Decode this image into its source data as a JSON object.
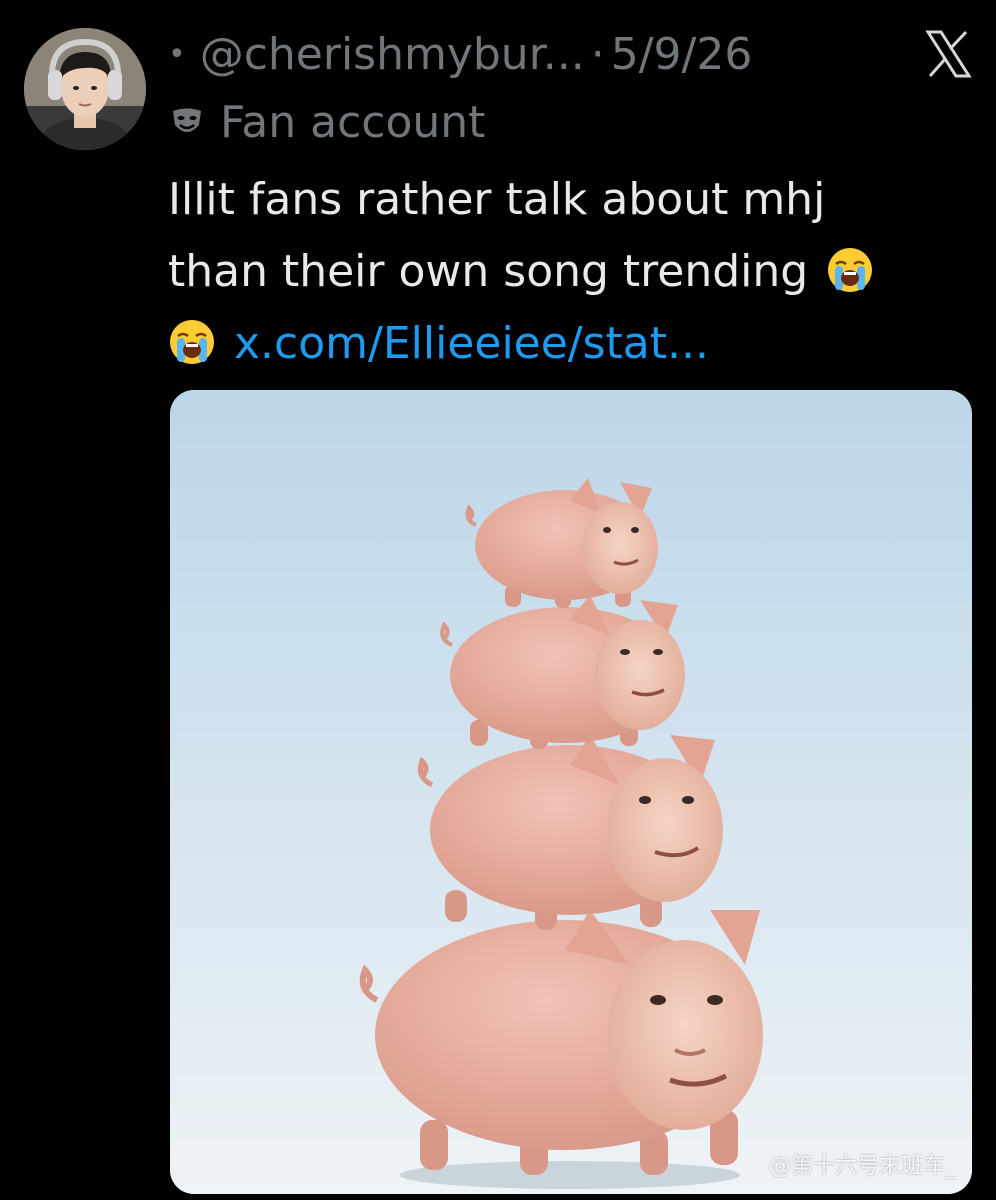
{
  "tweet": {
    "handle": "@cherishmybur...",
    "separator": "·",
    "date": "5/9/26",
    "label": "Fan account",
    "text_line1": "Illit fans rather talk about mhj",
    "text_line2": "than their own song trending",
    "link": "x.com/Ellieeiee/stat..."
  },
  "media": {
    "watermark": "@第十六号末班车_"
  },
  "icons": {
    "avatar": "profile-photo",
    "label_icon": "theater-mask-icon",
    "emoji": "loudly-crying-face-emoji",
    "brand": "x-logo-icon"
  },
  "colors": {
    "background": "#000000",
    "text": "#e7e9ea",
    "muted": "#71767b",
    "link": "#1d9bf0"
  }
}
